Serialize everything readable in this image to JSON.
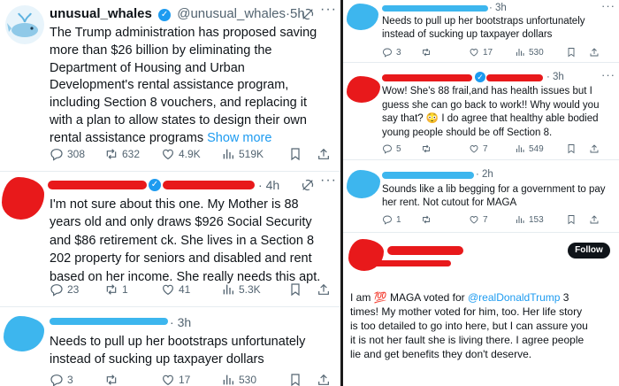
{
  "left": {
    "tweet1": {
      "name": "unusual_whales",
      "handle": "@unusual_whales",
      "separator": "·",
      "time": "5h",
      "lines": [
        "The Trump administration has proposed saving",
        "more than $26 billion by eliminating the",
        "Department of Housing and Urban",
        "Development's rental assistance program,",
        "including Section 8 vouchers, and replacing it",
        "with a plan to allow states to design their own",
        "rental assistance programs"
      ],
      "show_more": "Show more",
      "replies": "308",
      "reposts": "632",
      "likes": "4.9K",
      "views": "519K"
    },
    "tweet2": {
      "time": "4h",
      "lines": [
        "I'm not sure about this one. My Mother is 88",
        "years old and only draws $926 Social Security",
        "and $86 retirement ck. She lives in a Section 8",
        "202 property for seniors and disabled and rent",
        "based on her income.  She really needs this apt."
      ],
      "replies": "23",
      "reposts": "1",
      "likes": "41",
      "views": "5.3K"
    },
    "tweet3": {
      "time": "3h",
      "lines": [
        "Needs to pull up her bootstraps unfortunately",
        "instead of sucking up taxpayer dollars"
      ],
      "replies": "3",
      "reposts": "",
      "likes": "17",
      "views": "530"
    }
  },
  "right": {
    "tweet1": {
      "time": "3h",
      "lines": [
        "Needs to pull up her bootstraps unfortunately",
        "instead of sucking up taxpayer dollars"
      ],
      "replies": "3",
      "reposts": "",
      "likes": "17",
      "views": "530"
    },
    "tweet2": {
      "time": "3h",
      "lines": [
        "Wow! She's 88 frail,and has health issues but I",
        "guess she can go back to work!! Why would you",
        "say that? 😳 I do agree that healthy able bodied",
        "young people should be off Section 8."
      ],
      "replies": "5",
      "reposts": "",
      "likes": "7",
      "views": "549"
    },
    "tweet3": {
      "time": "2h",
      "lines": [
        "Sounds like a lib begging for a government to pay",
        "her rent. Not cutout for MAGA"
      ],
      "replies": "1",
      "reposts": "",
      "likes": "7",
      "views": "153"
    },
    "tweet4": {
      "follow": "Follow",
      "line1_prefix": "I am ",
      "line1_emoji": "💯",
      "line1_mid": " MAGA voted for ",
      "line1_link": "@realDonaldTrump",
      "line1_suffix": " 3",
      "lines": [
        "times!  My mother voted for him, too. Her life story",
        "is too detailed to go into here, but I can assure you",
        "it is not her fault she is living there. I agree people",
        "lie and get benefits they don't deserve."
      ]
    }
  },
  "colors": {
    "accent": "#1d9bf0",
    "redaction_red": "#e8191b",
    "redaction_blue": "#3db6ee",
    "text": "#0f1419",
    "muted": "#536471"
  }
}
